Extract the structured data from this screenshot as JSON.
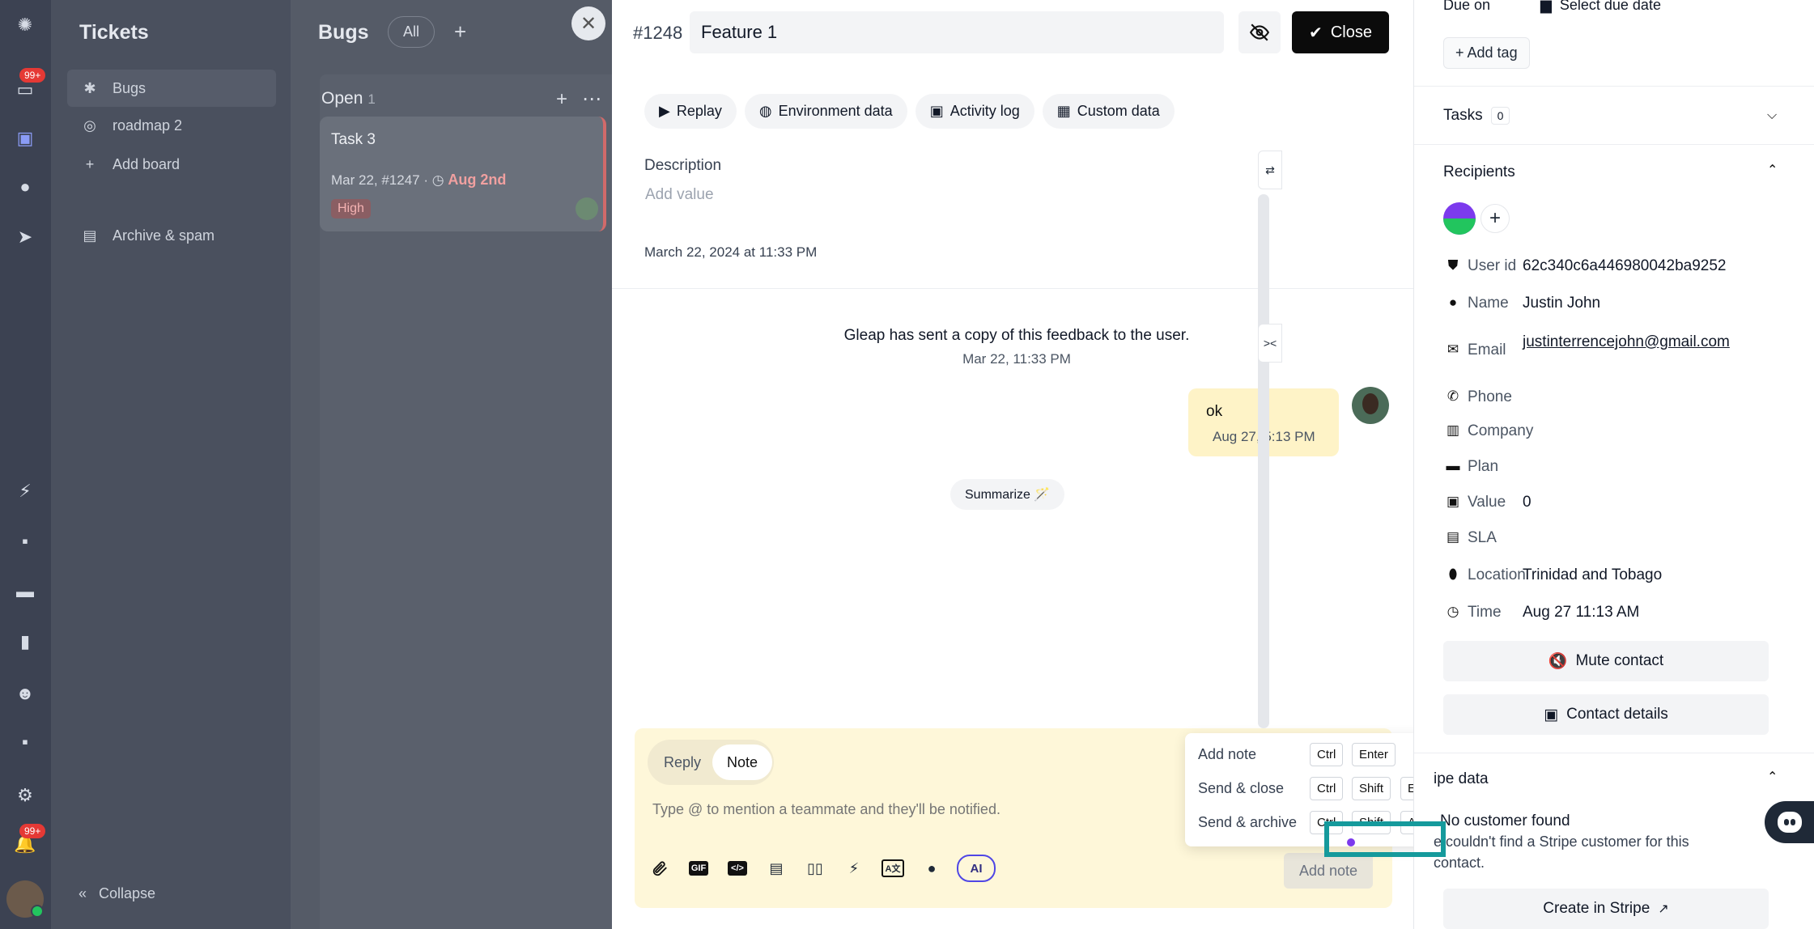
{
  "sidebar": {
    "title": "Tickets",
    "items": [
      {
        "label": "Bugs",
        "icon": "bug-icon"
      },
      {
        "label": "roadmap 2",
        "icon": "target-icon"
      },
      {
        "label": "Add board",
        "icon": "plus-icon"
      },
      {
        "label": "Archive & spam",
        "icon": "archive-icon"
      }
    ],
    "collapse_label": "Collapse",
    "rail_badge_top": "99+",
    "rail_badge_bottom": "99+"
  },
  "board": {
    "title": "Bugs",
    "filter_label": "All",
    "column": {
      "title": "Open",
      "count": "1"
    },
    "card": {
      "title": "Task 3",
      "meta": "Mar 22, #1247 ·",
      "due": "Aug 2nd",
      "priority": "High"
    }
  },
  "ticket": {
    "id": "#1248",
    "title": "Feature 1",
    "close_label": "Close",
    "tabs": [
      {
        "label": "Replay",
        "icon": "play-icon"
      },
      {
        "label": "Environment data",
        "icon": "globe-icon"
      },
      {
        "label": "Activity log",
        "icon": "terminal-icon"
      },
      {
        "label": "Custom data",
        "icon": "table-icon"
      }
    ],
    "description_label": "Description",
    "description_placeholder": "Add value",
    "created_at": "March 22, 2024 at 11:33 PM"
  },
  "conversation": {
    "system_message": "Gleap has sent a copy of this feedback to the user.",
    "system_time": "Mar 22, 11:33 PM",
    "message_text": "ok",
    "message_time": "Aug 27, 5:13 PM",
    "summarize_label": "Summarize 🪄"
  },
  "composer": {
    "mode_reply": "Reply",
    "mode_note": "Note",
    "placeholder": "Type @ to mention a teammate and they'll be notified.",
    "submit_label": "Add note",
    "ai_label": "AI",
    "gif_label": "GIF"
  },
  "send_menu": [
    {
      "label": "Add note",
      "keys": [
        "Ctrl",
        "Enter"
      ]
    },
    {
      "label": "Send & close",
      "keys": [
        "Ctrl",
        "Shift",
        "Enter"
      ]
    },
    {
      "label": "Send & archive",
      "keys": [
        "Ctrl",
        "Shift",
        "A"
      ]
    }
  ],
  "details": {
    "due_label": "Due on",
    "due_value": "Select due date",
    "add_tag": "Add tag",
    "tasks_label": "Tasks",
    "tasks_count": "0",
    "recipients_label": "Recipients",
    "attributes": [
      {
        "label": "User id",
        "value": "62c340c6a446980042ba9252",
        "icon": "shield-icon"
      },
      {
        "label": "Name",
        "value": "Justin John",
        "icon": "person-icon"
      },
      {
        "label": "Email",
        "value": "justinterrencejohn@gmail.com",
        "icon": "mail-icon"
      },
      {
        "label": "Phone",
        "value": "",
        "icon": "phone-icon"
      },
      {
        "label": "Company",
        "value": "",
        "icon": "building-icon"
      },
      {
        "label": "Plan",
        "value": "",
        "icon": "card-icon"
      },
      {
        "label": "Value",
        "value": "0",
        "icon": "money-icon"
      },
      {
        "label": "SLA",
        "value": "",
        "icon": "document-icon"
      },
      {
        "label": "Location",
        "value": "Trinidad and Tobago",
        "icon": "pin-icon"
      },
      {
        "label": "Time",
        "value": "Aug 27 11:13 AM",
        "icon": "clock-icon"
      }
    ],
    "mute_label": "Mute contact",
    "contact_label": "Contact details",
    "stripe_title": "ipe data",
    "stripe_none": "No customer found",
    "stripe_desc1": "e couldn't find a Stripe customer for this",
    "stripe_desc2": "contact.",
    "stripe_create": "Create in Stripe"
  }
}
